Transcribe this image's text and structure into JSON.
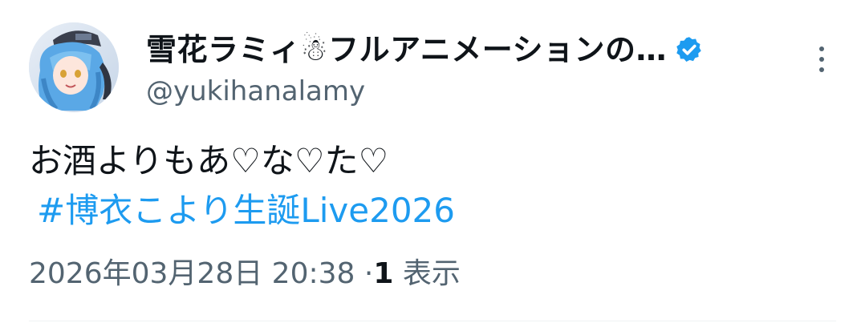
{
  "author": {
    "display_name": "雪花ラミィ☃フルアニメーションの…",
    "handle": "@yukihanalamy",
    "verified": true,
    "avatar_icon": "avatar-icon"
  },
  "tweet": {
    "text": "お酒よりもあ♡な♡た♡",
    "hashtag": "#博衣こより生誕Live2026",
    "timestamp": "2026年03月28日 20:38",
    "separator": "·",
    "views_count": "1",
    "views_label": "表示"
  },
  "colors": {
    "link": "#1d9bf0",
    "secondary_text": "#536471",
    "primary_text": "#0f1419",
    "verified_badge": "#1d9bf0"
  }
}
